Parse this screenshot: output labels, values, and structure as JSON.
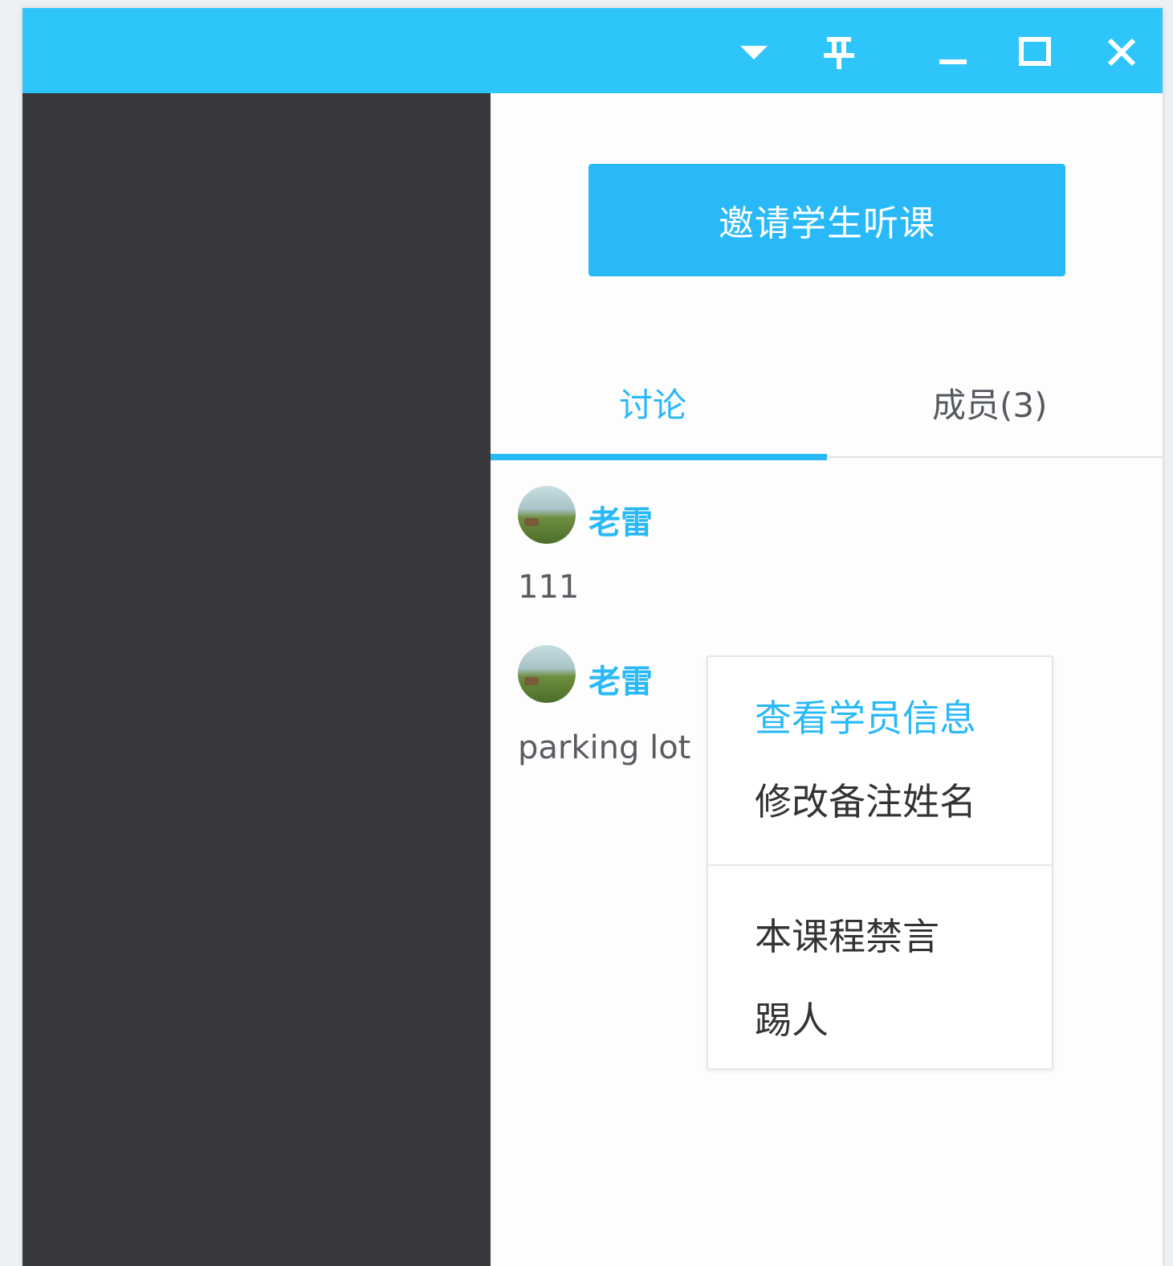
{
  "window": {
    "controls": [
      "dropdown-icon",
      "pin-icon",
      "minimize-icon",
      "maximize-icon",
      "close-icon"
    ]
  },
  "colors": {
    "titlebar": "#2ec5fb",
    "accent": "#2ab9f8",
    "sidebar": "#37393d"
  },
  "invite_button": {
    "label": "邀请学生听课"
  },
  "tabs": [
    {
      "label": "讨论",
      "active": true
    },
    {
      "label": "成员(3)",
      "active": false
    }
  ],
  "messages": [
    {
      "user": "老雷",
      "text": "111"
    },
    {
      "user": "老雷",
      "text": "parking lot"
    }
  ],
  "context_menu": {
    "items": [
      {
        "label": "查看学员信息",
        "highlighted": true
      },
      {
        "label": "修改备注姓名",
        "highlighted": false
      },
      {
        "label": "本课程禁言",
        "highlighted": false
      },
      {
        "label": "踢人",
        "highlighted": false
      }
    ]
  }
}
